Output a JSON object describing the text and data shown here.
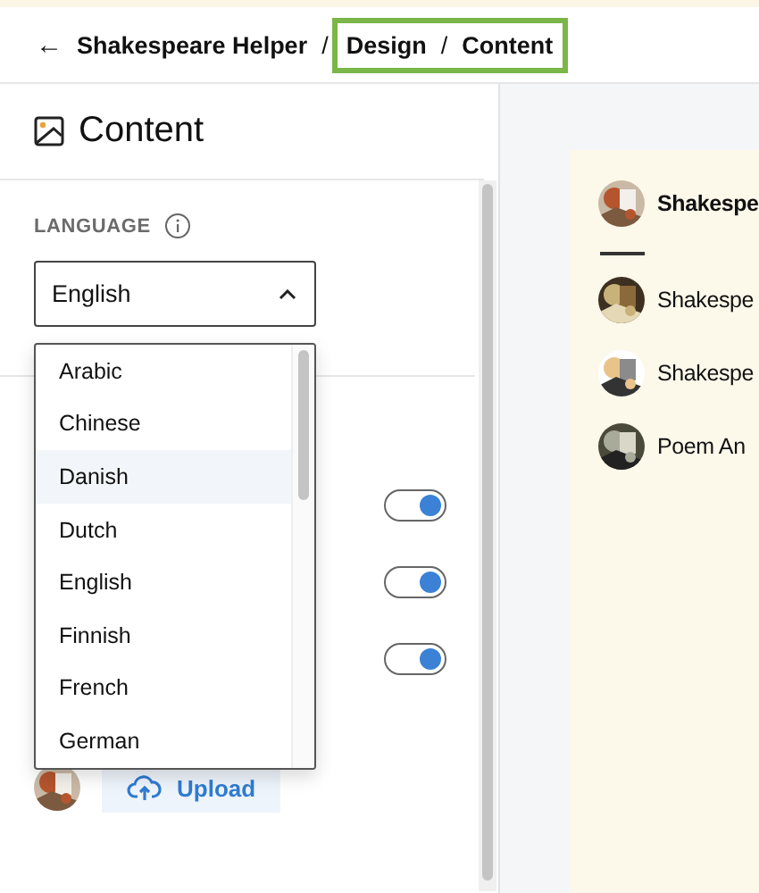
{
  "breadcrumb": {
    "back_icon": "←",
    "items": [
      {
        "label": "Shakespeare Helper",
        "highlighted": false
      },
      {
        "label": "Design",
        "highlighted": true
      },
      {
        "label": "Content",
        "highlighted": true
      }
    ],
    "separator": "/"
  },
  "panel": {
    "title": "Content",
    "language": {
      "label": "LANGUAGE",
      "value": "English",
      "expanded": true,
      "options": [
        {
          "label": "Arabic",
          "highlighted": false
        },
        {
          "label": "Chinese",
          "highlighted": false
        },
        {
          "label": "Danish",
          "highlighted": true
        },
        {
          "label": "Dutch",
          "highlighted": false
        },
        {
          "label": "English",
          "highlighted": false
        },
        {
          "label": "Finnish",
          "highlighted": false
        },
        {
          "label": "French",
          "highlighted": false
        },
        {
          "label": "German",
          "highlighted": false
        }
      ]
    },
    "toggles": [
      {
        "on": true
      },
      {
        "on": true
      },
      {
        "on": true
      }
    ],
    "upload": {
      "label": "Upload"
    }
  },
  "preview": {
    "header": "Shakespe",
    "items": [
      {
        "label": "Shakespe"
      },
      {
        "label": "Shakespe"
      },
      {
        "label": "Poem An"
      }
    ]
  }
}
